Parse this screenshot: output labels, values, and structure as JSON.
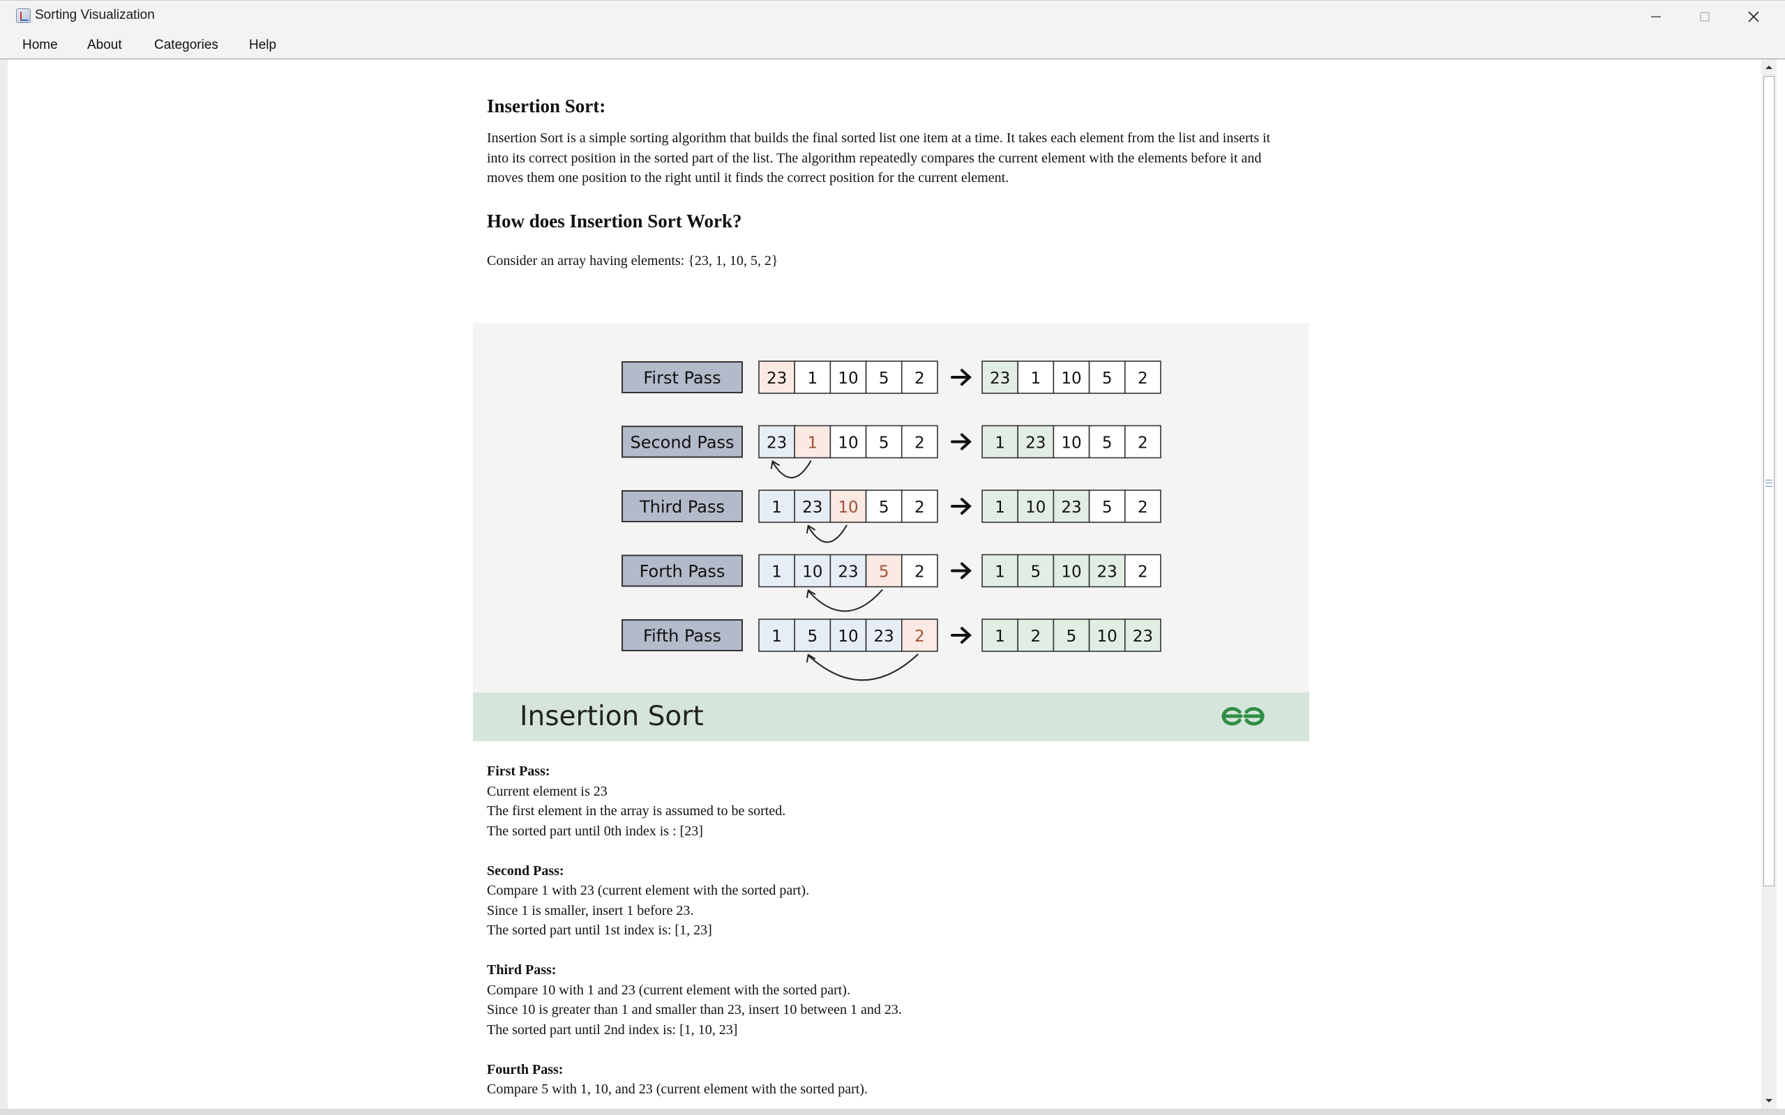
{
  "window": {
    "title": "Sorting Visualization"
  },
  "menu": [
    "Home",
    "About",
    "Categories",
    "Help"
  ],
  "article": {
    "title": "Insertion Sort:",
    "intro": "Insertion Sort is a simple sorting algorithm that builds the final sorted list one item at a time. It takes each element from the list and inserts it into its correct position in the sorted part of the list. The algorithm repeatedly compares the current element with the elements before it and moves them one position to the right until it finds the correct position for the current element.",
    "how_heading": "How does Insertion Sort Work?",
    "consider": "Consider an array having elements: {23, 1, 10, 5, 2}"
  },
  "diagram": {
    "caption": "Insertion Sort",
    "logo": "gfg-logo",
    "colors": {
      "background": "#f4f4f4",
      "label_box": "#b3bac9",
      "band": "#d5e5da",
      "current": "#fbe9e3",
      "sorted": "#e2ede3",
      "compare": "#e6edf4",
      "logo": "#2f8d46"
    },
    "rows": [
      {
        "label": "First Pass",
        "before": [
          "23",
          "1",
          "10",
          "5",
          "2"
        ],
        "after": [
          "23",
          "1",
          "10",
          "5",
          "2"
        ],
        "current": 0,
        "sorted_after": 1
      },
      {
        "label": "Second Pass",
        "before": [
          "23",
          "1",
          "10",
          "5",
          "2"
        ],
        "after": [
          "1",
          "23",
          "10",
          "5",
          "2"
        ],
        "current": 1,
        "sorted_after": 2
      },
      {
        "label": "Third Pass",
        "before": [
          "1",
          "23",
          "10",
          "5",
          "2"
        ],
        "after": [
          "1",
          "10",
          "23",
          "5",
          "2"
        ],
        "current": 2,
        "sorted_after": 3
      },
      {
        "label": "Forth Pass",
        "before": [
          "1",
          "10",
          "23",
          "5",
          "2"
        ],
        "after": [
          "1",
          "5",
          "10",
          "23",
          "2"
        ],
        "current": 3,
        "sorted_after": 4
      },
      {
        "label": "Fifth Pass",
        "before": [
          "1",
          "5",
          "10",
          "23",
          "2"
        ],
        "after": [
          "1",
          "2",
          "5",
          "10",
          "23"
        ],
        "current": 4,
        "sorted_after": 5
      }
    ]
  },
  "passes": [
    {
      "title": "First Pass:",
      "lines": [
        "Current element is 23",
        "The first element in the array is assumed to be sorted.",
        "The sorted part until 0th index is : [23]"
      ]
    },
    {
      "title": "Second Pass:",
      "lines": [
        "Compare 1 with 23 (current element with the sorted part).",
        "Since 1 is smaller, insert 1 before 23.",
        "The sorted part until 1st index is: [1, 23]"
      ]
    },
    {
      "title": "Third Pass:",
      "lines": [
        "Compare 10 with 1 and 23 (current element with the sorted part).",
        "Since 10 is greater than 1 and smaller than 23, insert 10 between 1 and 23.",
        "The sorted part until 2nd index is: [1, 10, 23]"
      ]
    },
    {
      "title": "Fourth Pass:",
      "lines": [
        "Compare 5 with 1, 10, and 23 (current element with the sorted part)."
      ]
    }
  ]
}
